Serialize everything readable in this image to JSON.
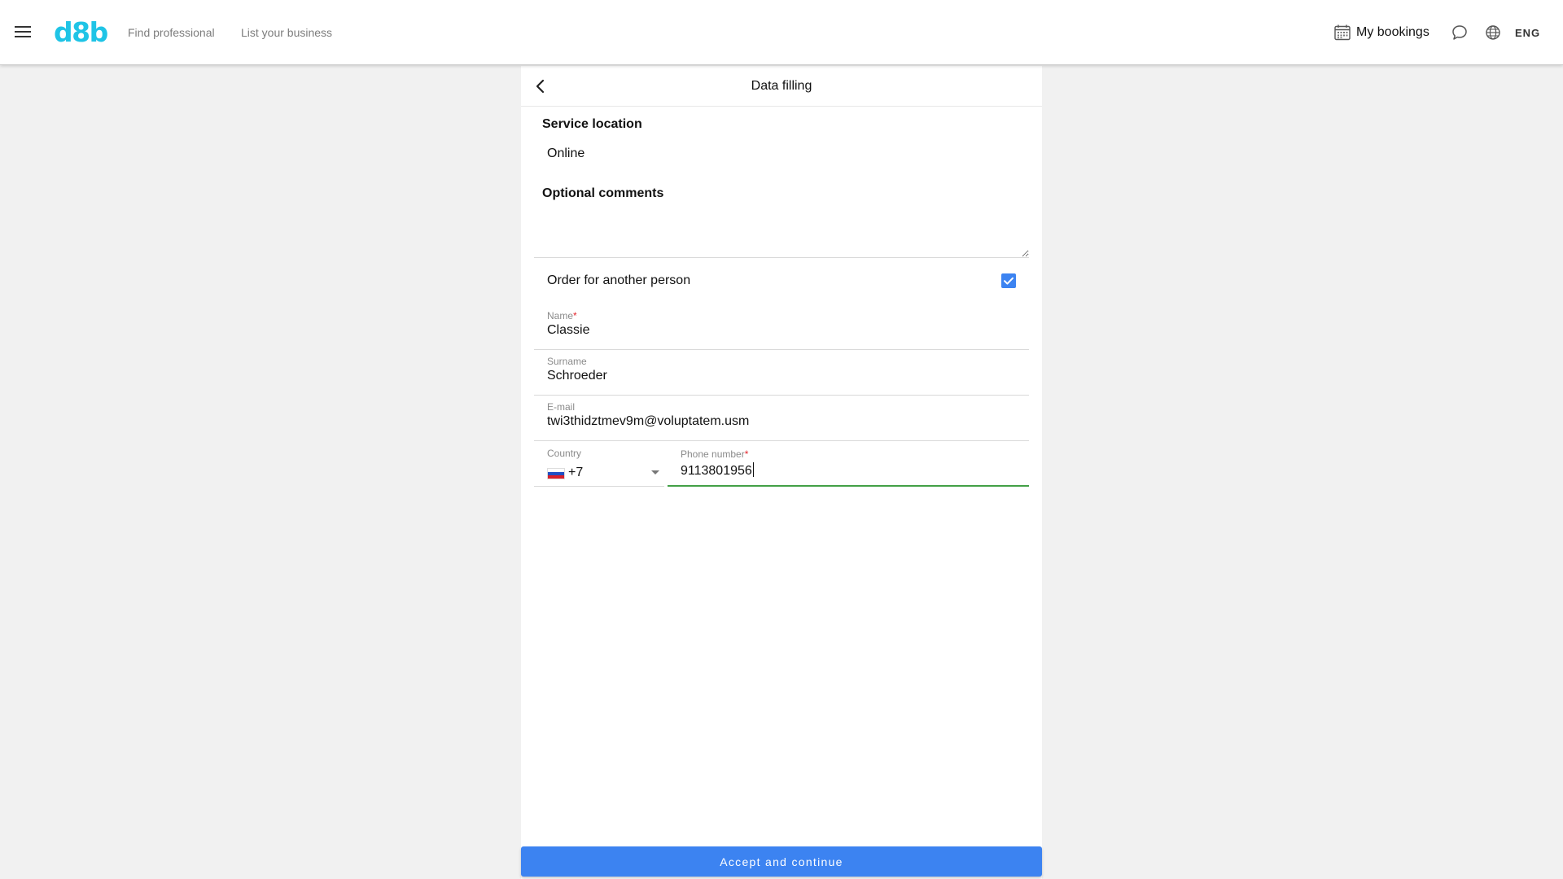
{
  "header": {
    "logo": "d8b",
    "nav": {
      "find_professional": "Find professional",
      "list_business": "List your business"
    },
    "bookings_label": "My bookings",
    "language": "ENG",
    "icons": [
      "menu-icon",
      "calendar-icon",
      "chat-icon",
      "globe-icon"
    ],
    "brand_color": "#1fc4e6"
  },
  "panel": {
    "title": "Data filling",
    "service_location_label": "Service location",
    "service_location_value": "Online",
    "optional_comments_label": "Optional comments",
    "optional_comments_value": "",
    "order_for_another_label": "Order for another person",
    "order_for_another_checked": true,
    "fields": {
      "name": {
        "label": "Name",
        "required": "*",
        "value": "Classie"
      },
      "surname": {
        "label": "Surname",
        "value": "Schroeder"
      },
      "email": {
        "label": "E-mail",
        "value": "twi3thidztmev9m@voluptatem.usm"
      },
      "country": {
        "label": "Country",
        "code": "+7",
        "flag": "russia-flag"
      },
      "phone": {
        "label": "Phone number",
        "required": "*",
        "value": "9113801956"
      }
    },
    "accept_button": "Accept and continue",
    "accent_color": "#3c83f1",
    "focus_color": "#43a047"
  }
}
